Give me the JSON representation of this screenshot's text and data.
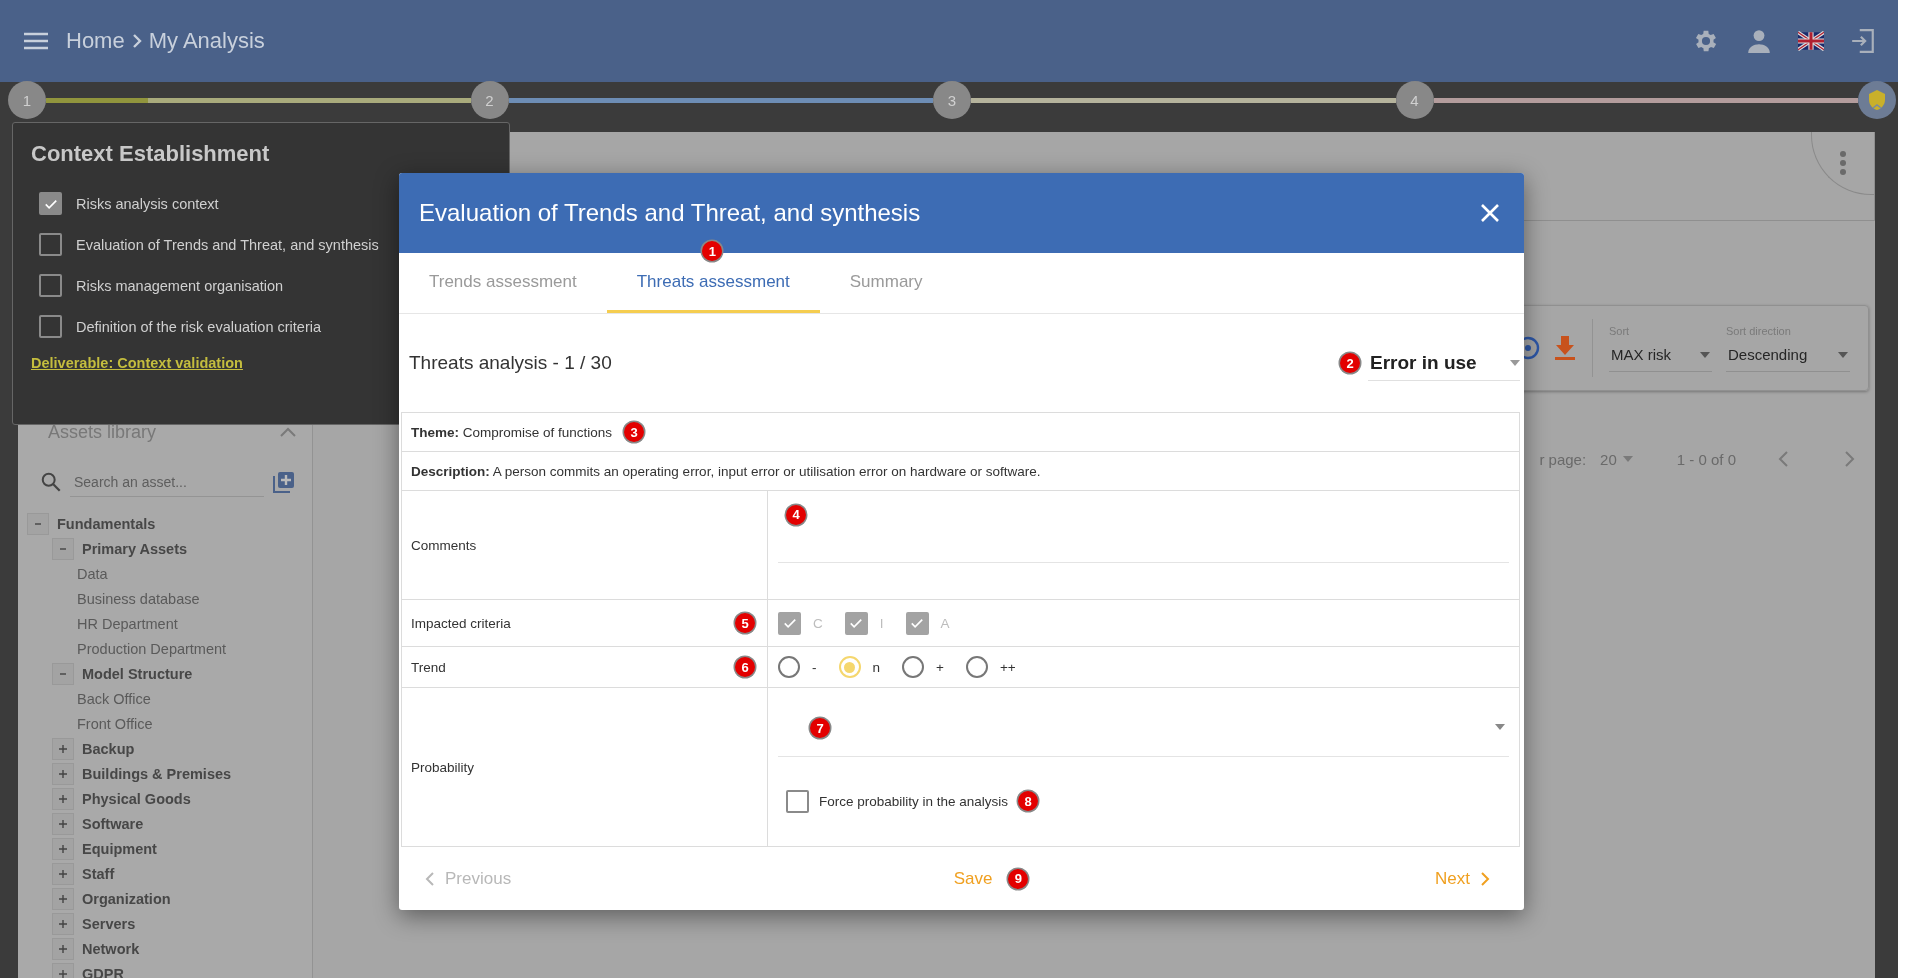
{
  "header": {
    "breadcrumb": [
      "Home",
      "My Analysis"
    ]
  },
  "steps": [
    {
      "label": "1",
      "color": "#a9ab7c",
      "level": 0.24
    },
    {
      "label": "2",
      "color": "#6d8db5"
    },
    {
      "label": "3",
      "color": "#b5b39c"
    },
    {
      "label": "4",
      "color": "#b39c9c"
    }
  ],
  "context_panel": {
    "title": "Context Establishment",
    "items": [
      {
        "label": "Risks analysis context",
        "checked": true
      },
      {
        "label": "Evaluation of Trends and Threat, and synthesis",
        "checked": false
      },
      {
        "label": "Risks management organisation",
        "checked": false
      },
      {
        "label": "Definition of the risk evaluation criteria",
        "checked": false
      }
    ],
    "link": "Deliverable: Context validation"
  },
  "sidebar": {
    "title": "Assets library",
    "search": {
      "placeholder": "Search an asset..."
    },
    "tree": [
      {
        "label": "Fundamentals",
        "expanded": true,
        "children": [
          {
            "label": "Primary Assets",
            "expanded": true,
            "children": [
              {
                "label": "Data"
              },
              {
                "label": "Business database"
              },
              {
                "label": "HR Department"
              },
              {
                "label": "Production Department"
              }
            ]
          },
          {
            "label": "Model Structure",
            "expanded": true,
            "children": [
              {
                "label": "Back Office"
              },
              {
                "label": "Front Office"
              }
            ]
          },
          {
            "label": "Backup",
            "expanded": false
          },
          {
            "label": "Buildings & Premises",
            "expanded": false
          },
          {
            "label": "Physical Goods",
            "expanded": false
          },
          {
            "label": "Software",
            "expanded": false
          },
          {
            "label": "Equipment",
            "expanded": false
          },
          {
            "label": "Staff",
            "expanded": false
          },
          {
            "label": "Organization",
            "expanded": false
          },
          {
            "label": "Servers",
            "expanded": false
          },
          {
            "label": "Network",
            "expanded": false
          },
          {
            "label": "GDPR",
            "expanded": false
          }
        ]
      }
    ]
  },
  "toolbar": {
    "sort": {
      "label": "Sort",
      "value": "MAX risk"
    },
    "sort_direction": {
      "label": "Sort direction",
      "value": "Descending"
    }
  },
  "pagination": {
    "rows_label": "r page:",
    "rows_value": "20",
    "range": "1 - 0 of 0"
  },
  "modal": {
    "title": "Evaluation of Trends and Threat, and synthesis",
    "tabs": [
      {
        "label": "Trends assessment",
        "selected": false
      },
      {
        "label": "Threats assessment",
        "selected": true,
        "callout": "1"
      },
      {
        "label": "Summary",
        "selected": false
      }
    ],
    "heading": "Threats analysis - 1 / 30",
    "threat_select": {
      "value": "Error in use",
      "callout": "2"
    },
    "theme": {
      "text": "**Theme:** Compromise of functions",
      "callout": "3"
    },
    "description": {
      "text": "**Description:** A person commits an operating error, input error or utilisation error on hardware or software."
    },
    "comments": {
      "label": "Comments",
      "callout": "4"
    },
    "impacted_criteria": {
      "label": "Impacted criteria",
      "callout": "5",
      "options": [
        {
          "label": "C",
          "checked": true,
          "disabled": true
        },
        {
          "label": "I",
          "checked": true,
          "disabled": true
        },
        {
          "label": "A",
          "checked": true,
          "disabled": true
        }
      ]
    },
    "trend": {
      "label": "Trend",
      "callout": "6",
      "options": [
        {
          "label": "-",
          "selected": false
        },
        {
          "label": "n",
          "selected": true
        },
        {
          "label": "+",
          "selected": false
        },
        {
          "label": "++",
          "selected": false
        }
      ]
    },
    "probability": {
      "label": "Probability",
      "select_callout": "7",
      "force": {
        "label": "Force probability in the analysis",
        "checked": false,
        "callout": "8"
      }
    },
    "footer": {
      "previous": {
        "label": "Previous",
        "disabled": true
      },
      "save": {
        "label": "Save",
        "callout": "9"
      },
      "next": {
        "label": "Next",
        "disabled": false
      }
    }
  }
}
